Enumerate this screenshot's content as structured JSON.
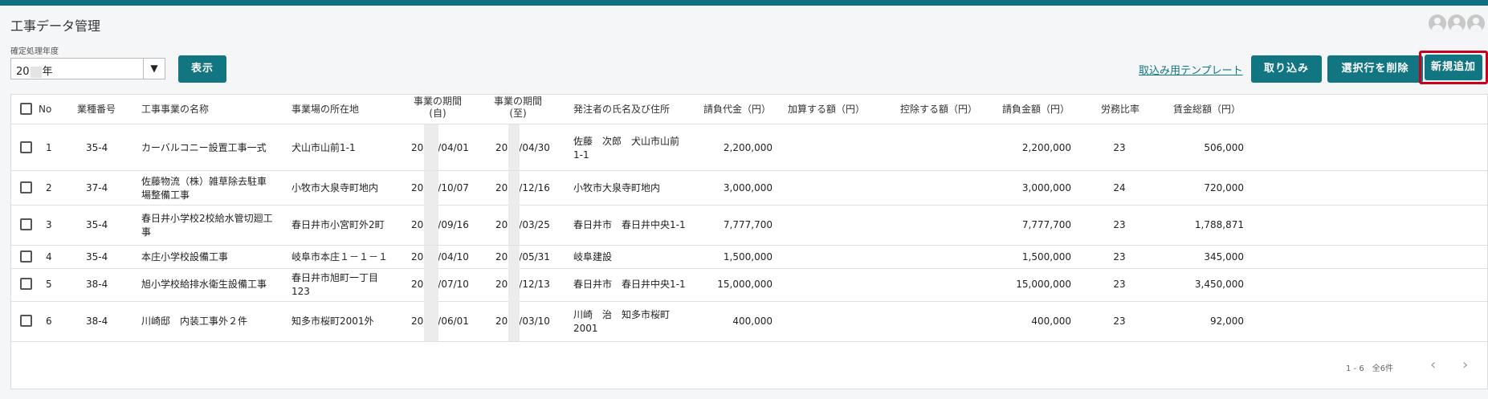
{
  "page": {
    "title": "工事データ管理"
  },
  "year_filter": {
    "label": "確定処理年度",
    "value_prefix": "20",
    "value_suffix": "年"
  },
  "buttons": {
    "show": "表示",
    "template_link": "取込み用テンプレート",
    "import": "取り込み",
    "delete_selected": "選択行を削除",
    "add_new": "新規追加"
  },
  "columns": [
    "No",
    "業種番号",
    "工事事業の名称",
    "事業場の所在地",
    "事業の期間\n(自)",
    "事業の期間\n(至)",
    "発注者の氏名及び住所",
    "請負代金（円）",
    "加算する額（円）",
    "控除する額（円）",
    "請負金額（円）",
    "労務比率",
    "賃金総額（円）"
  ],
  "rows": [
    {
      "no": "1",
      "code": "35-4",
      "name": "カーバルコニー設置工事一式",
      "location": "犬山市山前1-1",
      "from": "/04/01",
      "to": "/04/30",
      "client": "佐藤　次郎　犬山市山前\n1-1",
      "contract": "2,200,000",
      "add": "",
      "deduct": "",
      "amount": "2,200,000",
      "ratio": "23",
      "wage": "506,000"
    },
    {
      "no": "2",
      "code": "37-4",
      "name": "佐藤物流（株）雑草除去駐車\n場整備工事",
      "location": "小牧市大泉寺町地内",
      "from": "/10/07",
      "to": "/12/16",
      "client": "小牧市大泉寺町地内",
      "contract": "3,000,000",
      "add": "",
      "deduct": "",
      "amount": "3,000,000",
      "ratio": "24",
      "wage": "720,000"
    },
    {
      "no": "3",
      "code": "35-4",
      "name": "春日井小学校2校給水管切廻工\n事",
      "location": "春日井市小宮町外2町",
      "from": "/09/16",
      "to": "/03/25",
      "client": "春日井市　春日井中央1-1",
      "contract": "7,777,700",
      "add": "",
      "deduct": "",
      "amount": "7,777,700",
      "ratio": "23",
      "wage": "1,788,871"
    },
    {
      "no": "4",
      "code": "35-4",
      "name": "本庄小学校設備工事",
      "location": "岐阜市本庄１－１－１",
      "from": "/04/10",
      "to": "/05/31",
      "client": "岐阜建設",
      "contract": "1,500,000",
      "add": "",
      "deduct": "",
      "amount": "1,500,000",
      "ratio": "23",
      "wage": "345,000"
    },
    {
      "no": "5",
      "code": "38-4",
      "name": "旭小学校給排水衛生設備工事",
      "location": "春日井市旭町一丁目\n123",
      "from": "/07/10",
      "to": "/12/13",
      "client": "春日井市　春日井中央1-1",
      "contract": "15,000,000",
      "add": "",
      "deduct": "",
      "amount": "15,000,000",
      "ratio": "23",
      "wage": "3,450,000"
    },
    {
      "no": "6",
      "code": "38-4",
      "name": "川崎邸　内装工事外２件",
      "location": "知多市桜町2001外",
      "from": "/06/01",
      "to": "/03/10",
      "client": "川崎　治　知多市桜町\n2001",
      "contract": "400,000",
      "add": "",
      "deduct": "",
      "amount": "400,000",
      "ratio": "23",
      "wage": "92,000"
    }
  ],
  "date_prefix": "20",
  "pagination": {
    "range": "1 - 6　全6件",
    "prev": "‹",
    "next": "›"
  },
  "colors": {
    "accent": "#117582",
    "highlight": "#c8001e"
  }
}
